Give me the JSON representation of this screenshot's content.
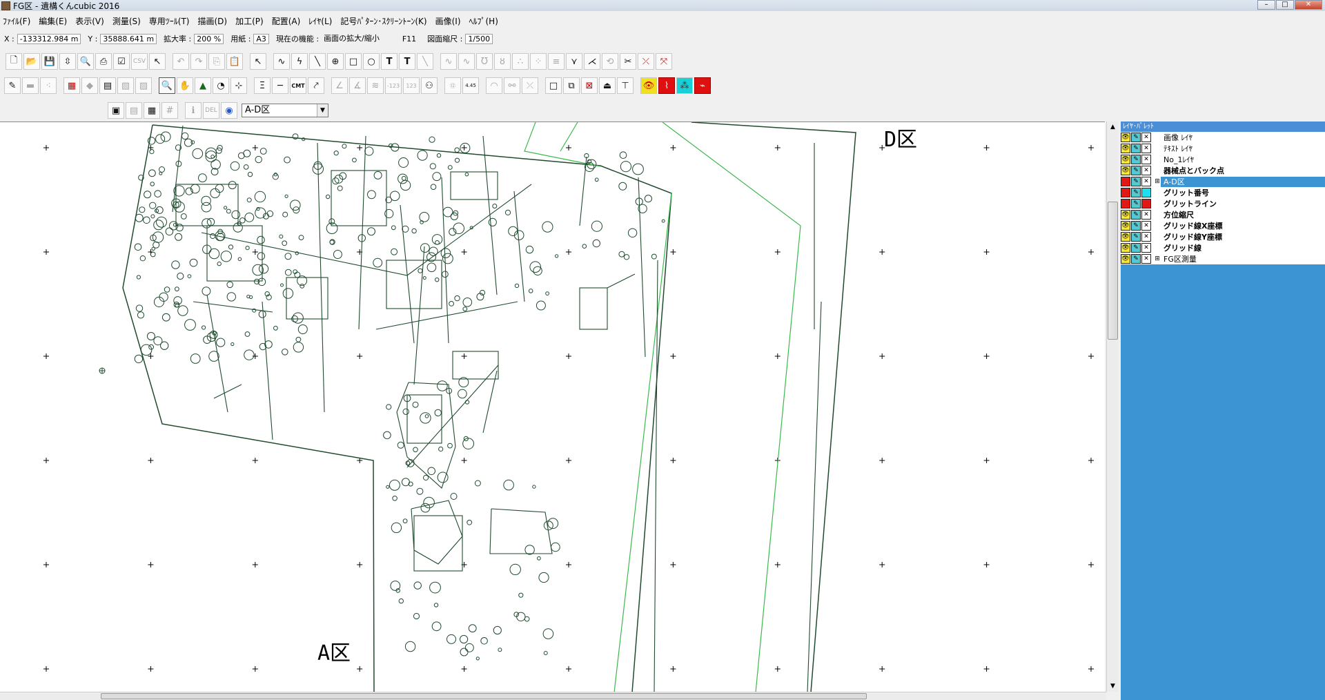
{
  "window": {
    "title": "FG区 - 遺構くんcubic 2016"
  },
  "menu": [
    "ﾌｧｲﾙ(F)",
    "編集(E)",
    "表示(V)",
    "測量(S)",
    "専用ﾂｰﾙ(T)",
    "描画(D)",
    "加工(P)",
    "配置(A)",
    "ﾚｲﾔ(L)",
    "記号ﾊﾟﾀｰﾝ･ｽｸﾘｰﾝﾄｰﾝ(K)",
    "画像(I)",
    "ﾍﾙﾌﾟ(H)"
  ],
  "status": {
    "x_label": "X :",
    "x_value": "-133312.984 m",
    "y_label": "Y :",
    "y_value": "35888.641 m",
    "zoom_label": "拡大率 :",
    "zoom_value": "200 %",
    "paper_label": "用紙 :",
    "paper_value": "A3",
    "func_label": "現在の機能 :",
    "func_value": "画面の拡大/縮小",
    "func_key": "F11",
    "scale_label": "図面縮尺 :",
    "scale_value": "1/500"
  },
  "toolbar": {
    "layer_select": "A-D区",
    "csv_label": "CSV",
    "del_label": "DEL"
  },
  "canvas": {
    "label_d": "D区",
    "label_a": "A区",
    "line_color": "#1f4a2e",
    "accent_line_color": "#3cb84a"
  },
  "palette": {
    "title": "ﾚｲﾔ･ﾊﾟﾚｯﾄ",
    "layers": [
      {
        "name": "画像 ﾚｲﾔ",
        "bold": false,
        "eye": "yellow",
        "lock": "x",
        "expand": ""
      },
      {
        "name": "ﾃｷｽﾄ ﾚｲﾔ",
        "bold": false,
        "eye": "yellow",
        "lock": "x",
        "expand": ""
      },
      {
        "name": "No_1ﾚｲﾔ",
        "bold": false,
        "eye": "yellow",
        "lock": "x",
        "expand": ""
      },
      {
        "name": "器械点とバック点",
        "bold": true,
        "eye": "yellow",
        "lock": "x",
        "expand": ""
      },
      {
        "name": "A-D区",
        "bold": false,
        "eye": "red",
        "lock": "x",
        "expand": "⊞",
        "selected": true
      },
      {
        "name": "グリット番号",
        "bold": true,
        "eye": "red",
        "lock": "cyan",
        "expand": ""
      },
      {
        "name": "グリットライン",
        "bold": true,
        "eye": "red",
        "lock": "red",
        "expand": ""
      },
      {
        "name": "方位縮尺",
        "bold": true,
        "eye": "yellow",
        "lock": "x",
        "expand": ""
      },
      {
        "name": "グリッド線X座標",
        "bold": true,
        "eye": "yellow",
        "lock": "x",
        "expand": ""
      },
      {
        "name": "グリッド線Y座標",
        "bold": true,
        "eye": "yellow",
        "lock": "x",
        "expand": ""
      },
      {
        "name": "グリッド線",
        "bold": true,
        "eye": "yellow",
        "lock": "x",
        "expand": ""
      },
      {
        "name": "FG区測量",
        "bold": false,
        "eye": "yellow",
        "lock": "x",
        "expand": "⊞"
      }
    ]
  }
}
